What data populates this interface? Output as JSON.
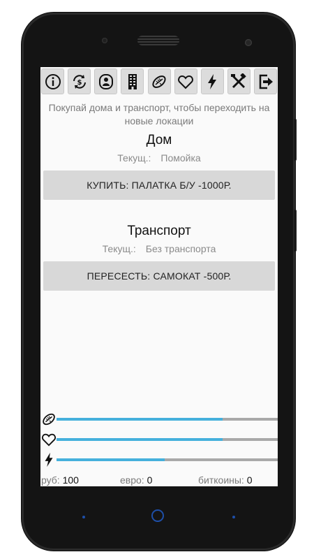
{
  "toolbar": {
    "buttons": [
      {
        "name": "info",
        "icon": "info-icon"
      },
      {
        "name": "exchange",
        "icon": "currency-exchange-icon"
      },
      {
        "name": "profile",
        "icon": "person-icon"
      },
      {
        "name": "housing",
        "icon": "building-icon"
      },
      {
        "name": "food",
        "icon": "food-icon"
      },
      {
        "name": "health",
        "icon": "heart-icon"
      },
      {
        "name": "energy",
        "icon": "lightning-icon"
      },
      {
        "name": "work",
        "icon": "tools-icon"
      },
      {
        "name": "exit",
        "icon": "exit-icon"
      }
    ]
  },
  "hint": "Покупай дома и транспорт, чтобы переходить на новые локации",
  "house": {
    "title": "Дом",
    "current_label": "Текущ.:",
    "current_value": "Помойка",
    "button_label": "КУПИТЬ:  ПАЛАТКА Б/У -1000Р."
  },
  "transport": {
    "title": "Транспорт",
    "current_label": "Текущ.:",
    "current_value": "Без транспорта",
    "button_label": "ПЕРЕСЕСТЬ:  САМОКАТ -500Р."
  },
  "stats": [
    {
      "icon": "food-icon",
      "level": 0.75
    },
    {
      "icon": "heart-icon",
      "level": 0.75
    },
    {
      "icon": "lightning-icon",
      "level": 0.49
    }
  ],
  "money": {
    "rub_label": "руб:",
    "rub_value": "100",
    "eur_label": "евро:",
    "eur_value": "0",
    "btc_label": "биткоины:",
    "btc_value": "0"
  },
  "colors": {
    "bar_fill": "#45b0dc",
    "bar_track": "#a9a9a9",
    "button_bg": "#d8d8d8",
    "nav_accent": "#1e4fa8"
  }
}
